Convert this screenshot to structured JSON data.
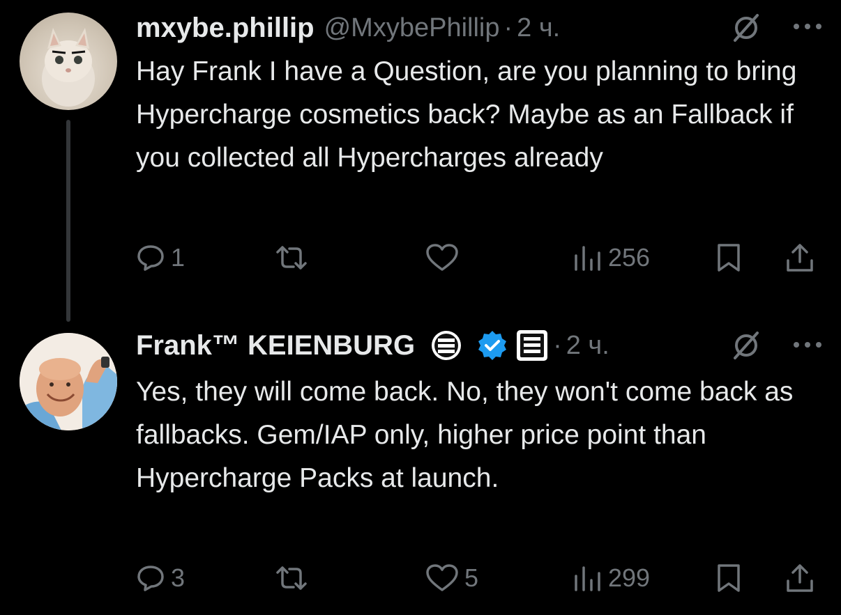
{
  "colors": {
    "background": "#000000",
    "text": "#e7e9ea",
    "muted": "#71767b",
    "verified": "#1d9bf0",
    "thread_line": "#333639"
  },
  "tweets": [
    {
      "author_name": "mxybe.phillip",
      "handle": "@MxybePhillip",
      "separator": "·",
      "time": "2 ч.",
      "text": "Hay Frank I have a Question, are you planning to bring Hypercharge cosmetics back? Maybe as an Fallback if you collected all Hypercharges already",
      "avatar_icon": "cat-avatar",
      "stats": {
        "replies": "1",
        "retweets": "",
        "likes": "",
        "views": "256"
      }
    },
    {
      "author_name": "Frank™ KEIENBURG",
      "handle": "",
      "separator": "·",
      "time": "2 ч.",
      "text": "Yes, they will come back. No, they won't come back as fallbacks. Gem/IAP only, higher price point than Hypercharge Packs at launch.",
      "avatar_icon": "person-avatar",
      "badges": [
        "supercell-circle-badge",
        "verified-badge",
        "supercell-square-badge"
      ],
      "stats": {
        "replies": "3",
        "retweets": "",
        "likes": "5",
        "views": "299"
      }
    }
  ]
}
